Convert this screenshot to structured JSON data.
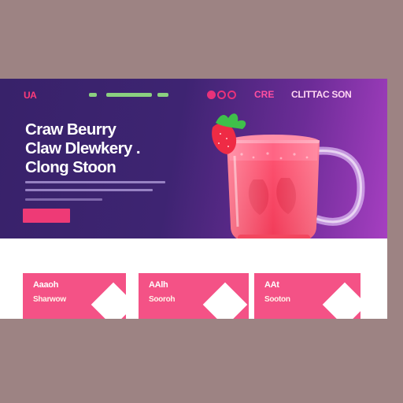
{
  "header": {
    "logo": "UA",
    "nav_care": "CRE",
    "nav_cta": "CLITTAC SON"
  },
  "hero": {
    "headline": [
      "Craw Beurry",
      "Claw Dlewkery .",
      "Clong Stoon"
    ]
  },
  "cards": [
    {
      "title": "Aaaoh",
      "sub": "Sharwow"
    },
    {
      "title": "AAlh",
      "sub": "Sooroh"
    },
    {
      "title": "AAt",
      "sub": "Sooton"
    }
  ],
  "colors": {
    "hero_bg": "#3e2472",
    "accent_pink": "#ee3a76",
    "card_pink": "#f45286",
    "nav_green": "#8bd080",
    "outer_bg": "#9d8383"
  },
  "icons": {
    "hero_image": "strawberry-juice-mug-icon",
    "nav_icons": [
      "circle-icon",
      "circle-icon",
      "circle-icon"
    ]
  }
}
